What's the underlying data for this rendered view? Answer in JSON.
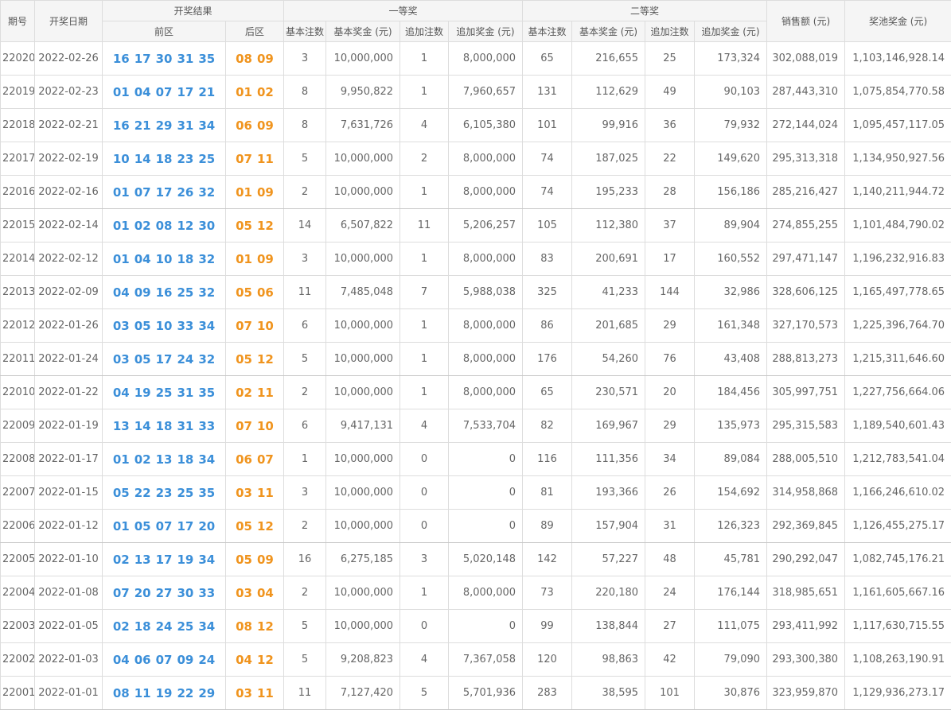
{
  "colors": {
    "front_ball": "#3b8fd9",
    "back_ball": "#f0941e",
    "header_bg": "#f5f5f5",
    "border": "#dddddd",
    "text": "#666666"
  },
  "header": {
    "issue": "期号",
    "date": "开奖日期",
    "result": "开奖结果",
    "front": "前区",
    "back": "后区",
    "first_prize": "一等奖",
    "second_prize": "二等奖",
    "basic_count": "基本注数",
    "basic_bonus": "基本奖金 (元)",
    "extra_count": "追加注数",
    "extra_bonus": "追加奖金 (元)",
    "sales": "销售额 (元)",
    "pool": "奖池奖金 (元)"
  },
  "rows": [
    {
      "issue": "22020",
      "date": "2022-02-26",
      "front": [
        "16",
        "17",
        "30",
        "31",
        "35"
      ],
      "back": [
        "08",
        "09"
      ],
      "p1_basic_count": "3",
      "p1_basic_bonus": "10,000,000",
      "p1_extra_count": "1",
      "p1_extra_bonus": "8,000,000",
      "p2_basic_count": "65",
      "p2_basic_bonus": "216,655",
      "p2_extra_count": "25",
      "p2_extra_bonus": "173,324",
      "sales": "302,088,019",
      "pool": "1,103,146,928.14"
    },
    {
      "issue": "22019",
      "date": "2022-02-23",
      "front": [
        "01",
        "04",
        "07",
        "17",
        "21"
      ],
      "back": [
        "01",
        "02"
      ],
      "p1_basic_count": "8",
      "p1_basic_bonus": "9,950,822",
      "p1_extra_count": "1",
      "p1_extra_bonus": "7,960,657",
      "p2_basic_count": "131",
      "p2_basic_bonus": "112,629",
      "p2_extra_count": "49",
      "p2_extra_bonus": "90,103",
      "sales": "287,443,310",
      "pool": "1,075,854,770.58"
    },
    {
      "issue": "22018",
      "date": "2022-02-21",
      "front": [
        "16",
        "21",
        "29",
        "31",
        "34"
      ],
      "back": [
        "06",
        "09"
      ],
      "p1_basic_count": "8",
      "p1_basic_bonus": "7,631,726",
      "p1_extra_count": "4",
      "p1_extra_bonus": "6,105,380",
      "p2_basic_count": "101",
      "p2_basic_bonus": "99,916",
      "p2_extra_count": "36",
      "p2_extra_bonus": "79,932",
      "sales": "272,144,024",
      "pool": "1,095,457,117.05"
    },
    {
      "issue": "22017",
      "date": "2022-02-19",
      "front": [
        "10",
        "14",
        "18",
        "23",
        "25"
      ],
      "back": [
        "07",
        "11"
      ],
      "p1_basic_count": "5",
      "p1_basic_bonus": "10,000,000",
      "p1_extra_count": "2",
      "p1_extra_bonus": "8,000,000",
      "p2_basic_count": "74",
      "p2_basic_bonus": "187,025",
      "p2_extra_count": "22",
      "p2_extra_bonus": "149,620",
      "sales": "295,313,318",
      "pool": "1,134,950,927.56"
    },
    {
      "issue": "22016",
      "date": "2022-02-16",
      "front": [
        "01",
        "07",
        "17",
        "26",
        "32"
      ],
      "back": [
        "01",
        "09"
      ],
      "p1_basic_count": "2",
      "p1_basic_bonus": "10,000,000",
      "p1_extra_count": "1",
      "p1_extra_bonus": "8,000,000",
      "p2_basic_count": "74",
      "p2_basic_bonus": "195,233",
      "p2_extra_count": "28",
      "p2_extra_bonus": "156,186",
      "sales": "285,216,427",
      "pool": "1,140,211,944.72"
    },
    {
      "issue": "22015",
      "date": "2022-02-14",
      "front": [
        "01",
        "02",
        "08",
        "12",
        "30"
      ],
      "back": [
        "05",
        "12"
      ],
      "p1_basic_count": "14",
      "p1_basic_bonus": "6,507,822",
      "p1_extra_count": "11",
      "p1_extra_bonus": "5,206,257",
      "p2_basic_count": "105",
      "p2_basic_bonus": "112,380",
      "p2_extra_count": "37",
      "p2_extra_bonus": "89,904",
      "sales": "274,855,255",
      "pool": "1,101,484,790.02"
    },
    {
      "issue": "22014",
      "date": "2022-02-12",
      "front": [
        "01",
        "04",
        "10",
        "18",
        "32"
      ],
      "back": [
        "01",
        "09"
      ],
      "p1_basic_count": "3",
      "p1_basic_bonus": "10,000,000",
      "p1_extra_count": "1",
      "p1_extra_bonus": "8,000,000",
      "p2_basic_count": "83",
      "p2_basic_bonus": "200,691",
      "p2_extra_count": "17",
      "p2_extra_bonus": "160,552",
      "sales": "297,471,147",
      "pool": "1,196,232,916.83"
    },
    {
      "issue": "22013",
      "date": "2022-02-09",
      "front": [
        "04",
        "09",
        "16",
        "25",
        "32"
      ],
      "back": [
        "05",
        "06"
      ],
      "p1_basic_count": "11",
      "p1_basic_bonus": "7,485,048",
      "p1_extra_count": "7",
      "p1_extra_bonus": "5,988,038",
      "p2_basic_count": "325",
      "p2_basic_bonus": "41,233",
      "p2_extra_count": "144",
      "p2_extra_bonus": "32,986",
      "sales": "328,606,125",
      "pool": "1,165,497,778.65"
    },
    {
      "issue": "22012",
      "date": "2022-01-26",
      "front": [
        "03",
        "05",
        "10",
        "33",
        "34"
      ],
      "back": [
        "07",
        "10"
      ],
      "p1_basic_count": "6",
      "p1_basic_bonus": "10,000,000",
      "p1_extra_count": "1",
      "p1_extra_bonus": "8,000,000",
      "p2_basic_count": "86",
      "p2_basic_bonus": "201,685",
      "p2_extra_count": "29",
      "p2_extra_bonus": "161,348",
      "sales": "327,170,573",
      "pool": "1,225,396,764.70"
    },
    {
      "issue": "22011",
      "date": "2022-01-24",
      "front": [
        "03",
        "05",
        "17",
        "24",
        "32"
      ],
      "back": [
        "05",
        "12"
      ],
      "p1_basic_count": "5",
      "p1_basic_bonus": "10,000,000",
      "p1_extra_count": "1",
      "p1_extra_bonus": "8,000,000",
      "p2_basic_count": "176",
      "p2_basic_bonus": "54,260",
      "p2_extra_count": "76",
      "p2_extra_bonus": "43,408",
      "sales": "288,813,273",
      "pool": "1,215,311,646.60"
    },
    {
      "issue": "22010",
      "date": "2022-01-22",
      "front": [
        "04",
        "19",
        "25",
        "31",
        "35"
      ],
      "back": [
        "02",
        "11"
      ],
      "p1_basic_count": "2",
      "p1_basic_bonus": "10,000,000",
      "p1_extra_count": "1",
      "p1_extra_bonus": "8,000,000",
      "p2_basic_count": "65",
      "p2_basic_bonus": "230,571",
      "p2_extra_count": "20",
      "p2_extra_bonus": "184,456",
      "sales": "305,997,751",
      "pool": "1,227,756,664.06"
    },
    {
      "issue": "22009",
      "date": "2022-01-19",
      "front": [
        "13",
        "14",
        "18",
        "31",
        "33"
      ],
      "back": [
        "07",
        "10"
      ],
      "p1_basic_count": "6",
      "p1_basic_bonus": "9,417,131",
      "p1_extra_count": "4",
      "p1_extra_bonus": "7,533,704",
      "p2_basic_count": "82",
      "p2_basic_bonus": "169,967",
      "p2_extra_count": "29",
      "p2_extra_bonus": "135,973",
      "sales": "295,315,583",
      "pool": "1,189,540,601.43"
    },
    {
      "issue": "22008",
      "date": "2022-01-17",
      "front": [
        "01",
        "02",
        "13",
        "18",
        "34"
      ],
      "back": [
        "06",
        "07"
      ],
      "p1_basic_count": "1",
      "p1_basic_bonus": "10,000,000",
      "p1_extra_count": "0",
      "p1_extra_bonus": "0",
      "p2_basic_count": "116",
      "p2_basic_bonus": "111,356",
      "p2_extra_count": "34",
      "p2_extra_bonus": "89,084",
      "sales": "288,005,510",
      "pool": "1,212,783,541.04"
    },
    {
      "issue": "22007",
      "date": "2022-01-15",
      "front": [
        "05",
        "22",
        "23",
        "25",
        "35"
      ],
      "back": [
        "03",
        "11"
      ],
      "p1_basic_count": "3",
      "p1_basic_bonus": "10,000,000",
      "p1_extra_count": "0",
      "p1_extra_bonus": "0",
      "p2_basic_count": "81",
      "p2_basic_bonus": "193,366",
      "p2_extra_count": "26",
      "p2_extra_bonus": "154,692",
      "sales": "314,958,868",
      "pool": "1,166,246,610.02"
    },
    {
      "issue": "22006",
      "date": "2022-01-12",
      "front": [
        "01",
        "05",
        "07",
        "17",
        "20"
      ],
      "back": [
        "05",
        "12"
      ],
      "p1_basic_count": "2",
      "p1_basic_bonus": "10,000,000",
      "p1_extra_count": "0",
      "p1_extra_bonus": "0",
      "p2_basic_count": "89",
      "p2_basic_bonus": "157,904",
      "p2_extra_count": "31",
      "p2_extra_bonus": "126,323",
      "sales": "292,369,845",
      "pool": "1,126,455,275.17"
    },
    {
      "issue": "22005",
      "date": "2022-01-10",
      "front": [
        "02",
        "13",
        "17",
        "19",
        "34"
      ],
      "back": [
        "05",
        "09"
      ],
      "p1_basic_count": "16",
      "p1_basic_bonus": "6,275,185",
      "p1_extra_count": "3",
      "p1_extra_bonus": "5,020,148",
      "p2_basic_count": "142",
      "p2_basic_bonus": "57,227",
      "p2_extra_count": "48",
      "p2_extra_bonus": "45,781",
      "sales": "290,292,047",
      "pool": "1,082,745,176.21"
    },
    {
      "issue": "22004",
      "date": "2022-01-08",
      "front": [
        "07",
        "20",
        "27",
        "30",
        "33"
      ],
      "back": [
        "03",
        "04"
      ],
      "p1_basic_count": "2",
      "p1_basic_bonus": "10,000,000",
      "p1_extra_count": "1",
      "p1_extra_bonus": "8,000,000",
      "p2_basic_count": "73",
      "p2_basic_bonus": "220,180",
      "p2_extra_count": "24",
      "p2_extra_bonus": "176,144",
      "sales": "318,985,651",
      "pool": "1,161,605,667.16"
    },
    {
      "issue": "22003",
      "date": "2022-01-05",
      "front": [
        "02",
        "18",
        "24",
        "25",
        "34"
      ],
      "back": [
        "08",
        "12"
      ],
      "p1_basic_count": "5",
      "p1_basic_bonus": "10,000,000",
      "p1_extra_count": "0",
      "p1_extra_bonus": "0",
      "p2_basic_count": "99",
      "p2_basic_bonus": "138,844",
      "p2_extra_count": "27",
      "p2_extra_bonus": "111,075",
      "sales": "293,411,992",
      "pool": "1,117,630,715.55"
    },
    {
      "issue": "22002",
      "date": "2022-01-03",
      "front": [
        "04",
        "06",
        "07",
        "09",
        "24"
      ],
      "back": [
        "04",
        "12"
      ],
      "p1_basic_count": "5",
      "p1_basic_bonus": "9,208,823",
      "p1_extra_count": "4",
      "p1_extra_bonus": "7,367,058",
      "p2_basic_count": "120",
      "p2_basic_bonus": "98,863",
      "p2_extra_count": "42",
      "p2_extra_bonus": "79,090",
      "sales": "293,300,380",
      "pool": "1,108,263,190.91"
    },
    {
      "issue": "22001",
      "date": "2022-01-01",
      "front": [
        "08",
        "11",
        "19",
        "22",
        "29"
      ],
      "back": [
        "03",
        "11"
      ],
      "p1_basic_count": "11",
      "p1_basic_bonus": "7,127,420",
      "p1_extra_count": "5",
      "p1_extra_bonus": "5,701,936",
      "p2_basic_count": "283",
      "p2_basic_bonus": "38,595",
      "p2_extra_count": "101",
      "p2_extra_bonus": "30,876",
      "sales": "323,959,870",
      "pool": "1,129,936,273.17"
    }
  ]
}
